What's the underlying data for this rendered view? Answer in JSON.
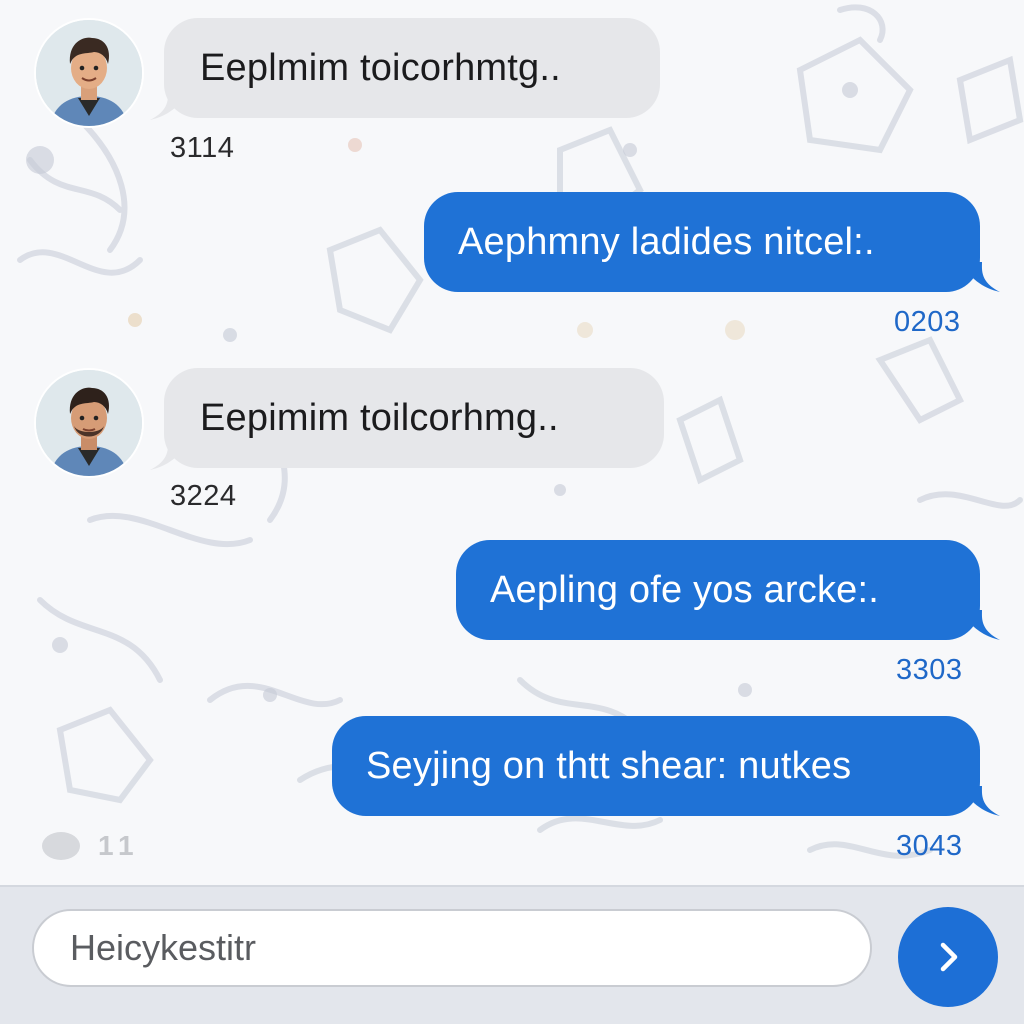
{
  "messages": [
    {
      "direction": "incoming",
      "text": "Eeplmim toicorhmtg..",
      "time": "3114"
    },
    {
      "direction": "outgoing",
      "text": "Aephmny ladides nitcel:.",
      "time": "0203"
    },
    {
      "direction": "incoming",
      "text": "Eepimim toilcorhmg..",
      "time": "3224"
    },
    {
      "direction": "outgoing",
      "text": "Aepling ofe yos arcke:.",
      "time": "3303"
    },
    {
      "direction": "outgoing",
      "text": "Seyjing on thtt shear: nutkes",
      "time": "3043"
    }
  ],
  "typing_indicator": {
    "count": "11"
  },
  "composer": {
    "placeholder": "Heicykestitr",
    "send_icon": "chevron-right-icon"
  },
  "colors": {
    "outgoing_bubble": "#1f72d6",
    "incoming_bubble": "#e6e7ea",
    "send_button": "#1d6fd6",
    "outgoing_time": "#1f68c8"
  }
}
